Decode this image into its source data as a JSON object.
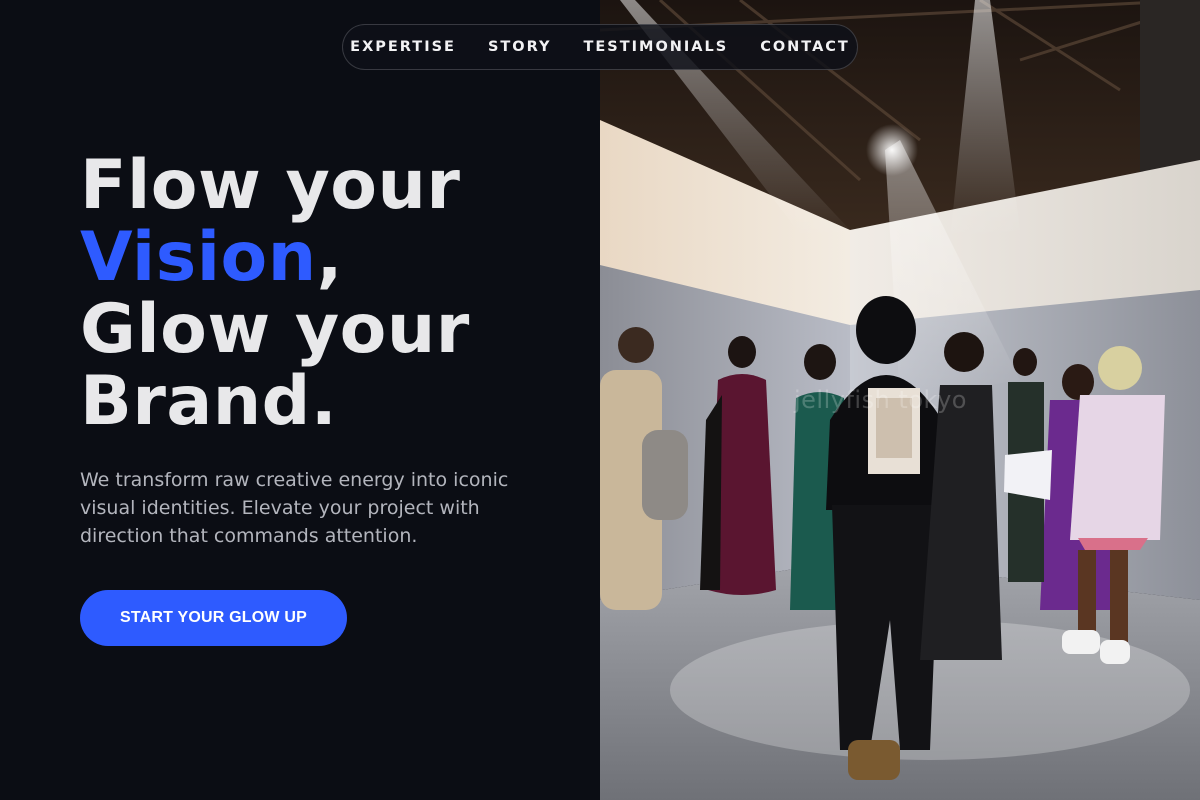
{
  "nav": {
    "items": [
      {
        "label": "EXPERTISE"
      },
      {
        "label": "STORY"
      },
      {
        "label": "TESTIMONIALS"
      },
      {
        "label": "CONTACT"
      }
    ]
  },
  "hero": {
    "headline_line1": "Flow your",
    "headline_accent": "Vision",
    "headline_comma": ",",
    "headline_line3": "Glow your",
    "headline_line4": "Brand.",
    "subtext": "We transform raw creative energy into iconic visual identities. Elevate your project with direction that commands attention.",
    "cta_label": "START YOUR GLOW UP"
  },
  "photo": {
    "watermark": "jellyfish tokyo"
  },
  "colors": {
    "background": "#0b0d14",
    "accent": "#2e5bff",
    "headline": "#e8e8ea",
    "body_text": "#b3b5bd"
  }
}
